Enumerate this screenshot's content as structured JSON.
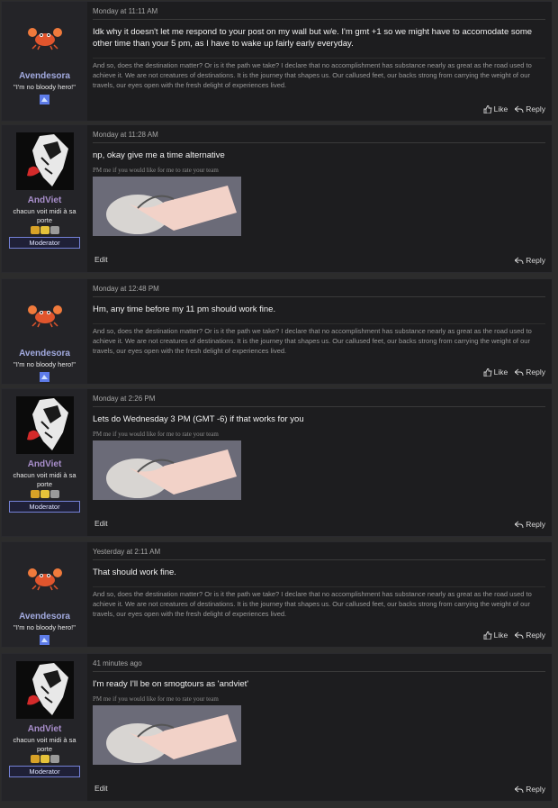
{
  "users": {
    "avendesora": {
      "name": "Avendesora",
      "title": "\"I'm no bloody hero!\""
    },
    "andviet": {
      "name": "AndViet",
      "title": "chacun voit midi à sa porte",
      "role": "Moderator"
    }
  },
  "signatures": {
    "avendesora": "And so, does the destination matter? Or is it the path we take? I declare that no accomplishment has substance nearly as great as the road used to achieve it. We are not creatures of destinations. It is the journey that shapes us. Our callused feet, our backs strong from carrying the weight of our travels, our eyes open with the fresh delight of experiences lived.",
    "andviet_pm": "PM me if you would like for me to rate your team"
  },
  "actions": {
    "like": "Like",
    "reply": "Reply",
    "edit": "Edit"
  },
  "posts": [
    {
      "time": "Monday at 11:11 AM",
      "text": "Idk why it doesn't let me respond to your post on my wall but w/e. I'm gmt +1 so we might have to accomodate some other time than your 5 pm, as I have to wake up fairly early everyday."
    },
    {
      "time": "Monday at 11:28 AM",
      "text": "np, okay give me a time alternative"
    },
    {
      "time": "Monday at 12:48 PM",
      "text": "Hm, any time before my 11 pm should work fine."
    },
    {
      "time": "Monday at 2:26 PM",
      "text": "Lets do Wednesday 3 PM (GMT -6) if that works for you"
    },
    {
      "time": "Yesterday at 2:11 AM",
      "text": "That should work fine."
    },
    {
      "time": "41 minutes ago",
      "text": "I'm ready I'll be on smogtours as 'andviet'"
    }
  ]
}
